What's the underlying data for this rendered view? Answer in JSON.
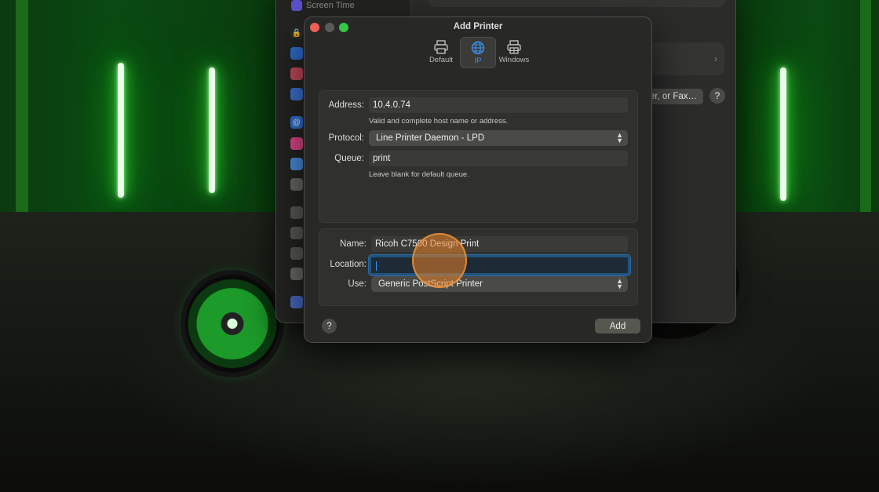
{
  "settings_window": {
    "sidebar_top_label": "Screen Time",
    "fax_button_label": "er, or Fax…",
    "help_label": "?",
    "row_chevron": "›"
  },
  "dialog": {
    "title": "Add Printer",
    "tabs": [
      {
        "label": "Default",
        "icon": "printer-icon",
        "active": false
      },
      {
        "label": "IP",
        "icon": "globe-icon",
        "active": true
      },
      {
        "label": "Windows",
        "icon": "windows-printer-icon",
        "active": false
      }
    ],
    "connection": {
      "address_label": "Address:",
      "address_value": "10.4.0.74",
      "address_hint": "Valid and complete host name or address.",
      "protocol_label": "Protocol:",
      "protocol_value": "Line Printer Daemon - LPD",
      "queue_label": "Queue:",
      "queue_value": "print",
      "queue_hint": "Leave blank for default queue."
    },
    "info": {
      "name_label": "Name:",
      "name_value": "Ricoh C7500 Design Print",
      "location_label": "Location:",
      "location_value": "",
      "use_label": "Use:",
      "use_value": "Generic PostScript Printer"
    },
    "help_label": "?",
    "add_label": "Add"
  },
  "colors": {
    "accent": "#3a8ff0",
    "close": "#ed5f57",
    "zoom": "#34c749",
    "click_indicator": "#e88228"
  }
}
